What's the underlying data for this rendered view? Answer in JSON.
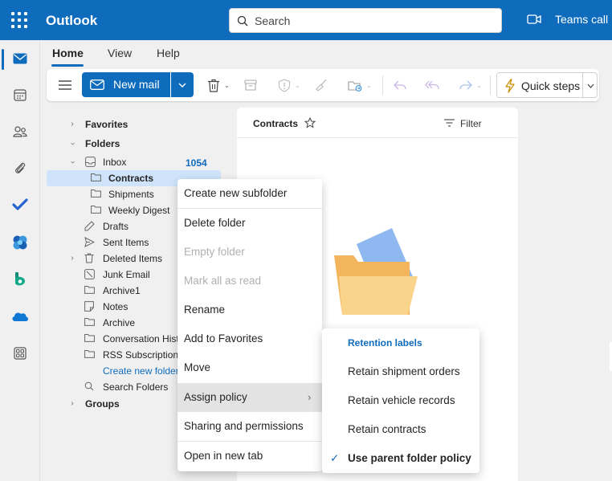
{
  "app": {
    "title": "Outlook"
  },
  "search": {
    "placeholder": "Search"
  },
  "teams": {
    "label": "Teams call"
  },
  "tabs": [
    {
      "label": "Home"
    },
    {
      "label": "View"
    },
    {
      "label": "Help"
    }
  ],
  "ribbon": {
    "new_mail": "New mail",
    "quick_steps": "Quick steps"
  },
  "folders": {
    "favorites": "Favorites",
    "folders_header": "Folders",
    "inbox": "Inbox",
    "inbox_count": "1054",
    "contracts": "Contracts",
    "shipments": "Shipments",
    "weekly_digest": "Weekly Digest",
    "drafts": "Drafts",
    "sent_items": "Sent Items",
    "deleted_items": "Deleted Items",
    "junk_email": "Junk Email",
    "archive1": "Archive1",
    "notes": "Notes",
    "archive": "Archive",
    "conversation_history": "Conversation Hist",
    "rss": "RSS Subscriptions",
    "create_new_folder": "Create new folder",
    "search_folders": "Search Folders",
    "groups": "Groups"
  },
  "list": {
    "title": "Contracts",
    "filter": "Filter"
  },
  "context_menu": {
    "create_subfolder": "Create new subfolder",
    "delete_folder": "Delete folder",
    "empty_folder": "Empty folder",
    "mark_all_read": "Mark all as read",
    "rename": "Rename",
    "add_favorites": "Add to Favorites",
    "move": "Move",
    "assign_policy": "Assign policy",
    "sharing": "Sharing and permissions",
    "open_new_tab": "Open in new tab"
  },
  "submenu": {
    "header": "Retention labels",
    "items": [
      "Retain shipment orders",
      "Retain vehicle records",
      "Retain contracts",
      "Use parent folder policy"
    ]
  },
  "colors": {
    "brand": "#0f6cbd",
    "selection": "#cfe4fa"
  }
}
